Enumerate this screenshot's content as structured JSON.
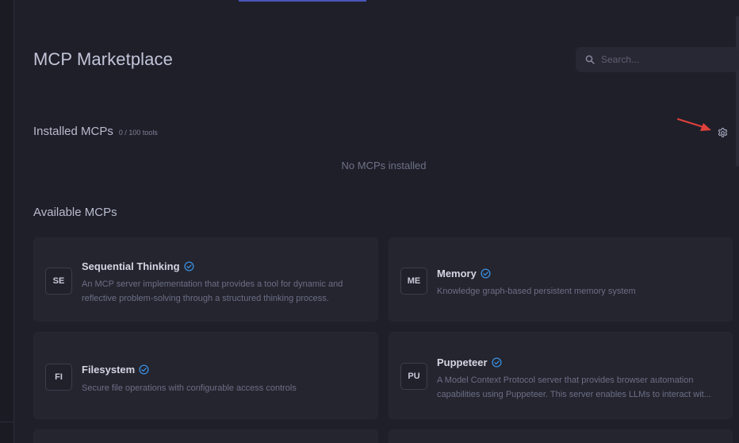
{
  "header": {
    "title": "MCP Marketplace",
    "search": {
      "placeholder": "Search...",
      "value": ""
    }
  },
  "installed": {
    "title": "Installed MCPs",
    "count_label": "0 / 100 tools",
    "empty_text": "No MCPs installed"
  },
  "available": {
    "title": "Available MCPs",
    "items": [
      {
        "badge": "SE",
        "name": "Sequential Thinking",
        "desc_lines": [
          "An MCP server implementation that provides a tool for dynamic and",
          "reflective problem-solving through a structured thinking process."
        ]
      },
      {
        "badge": "ME",
        "name": "Memory",
        "desc_lines": [
          "Knowledge graph-based persistent memory system"
        ]
      },
      {
        "badge": "FI",
        "name": "Filesystem",
        "desc_lines": [
          "Secure file operations with configurable access controls"
        ]
      },
      {
        "badge": "PU",
        "name": "Puppeteer",
        "desc_lines": [
          "A Model Context Protocol server that provides browser automation",
          "capabilities using Puppeteer. This server enables LLMs to interact wit..."
        ]
      }
    ]
  },
  "colors": {
    "background": "#1e1f29",
    "card": "#24252f",
    "accent": "#4b55b8",
    "verified": "#3b8fe0",
    "annotation_arrow": "#e0403c"
  },
  "icons": {
    "search": "search-icon",
    "settings": "gear-icon",
    "verified": "verified-check-icon",
    "annotation": "red-arrow-icon"
  }
}
